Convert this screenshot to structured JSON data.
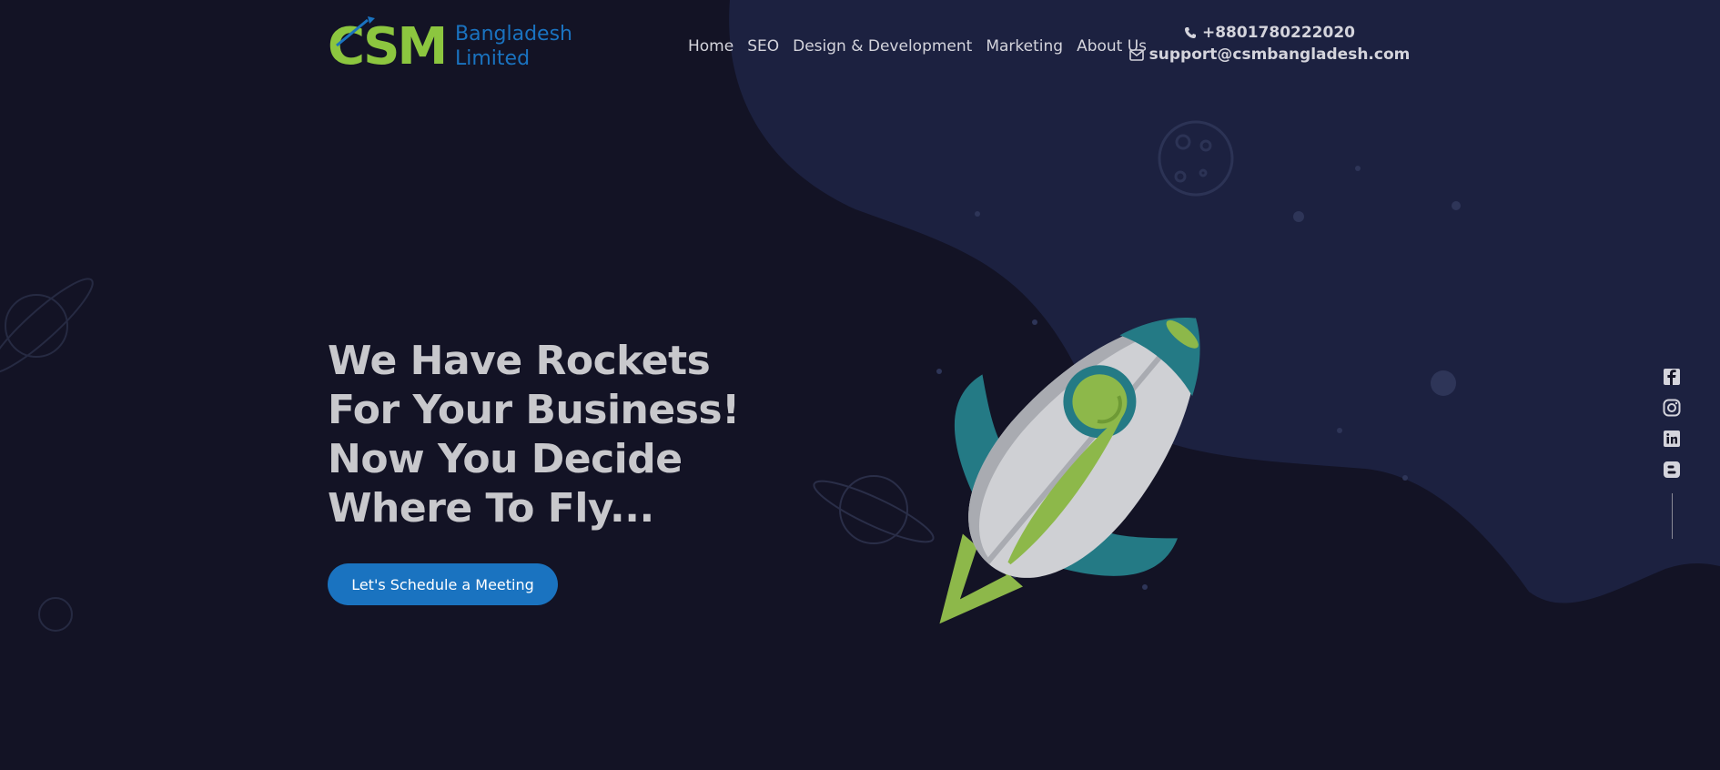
{
  "brand": {
    "logo_text": "CSM",
    "company_line1": "Bangladesh",
    "company_line2": "Limited",
    "colors": {
      "green": "#8cc63f",
      "blue": "#1a73c0"
    }
  },
  "nav": {
    "items": [
      {
        "label": "Home"
      },
      {
        "label": "SEO"
      },
      {
        "label": "Design & Development"
      },
      {
        "label": "Marketing"
      },
      {
        "label": "About Us"
      }
    ]
  },
  "contact": {
    "phone": "+8801780222020",
    "email": "support@csmbangladesh.com",
    "phone_icon": "phone-icon",
    "email_icon": "envelope-icon"
  },
  "hero": {
    "title_lines": [
      "We Have Rockets",
      "For Your Business!",
      "Now You Decide",
      "Where To Fly..."
    ],
    "cta_label": "Let's Schedule a Meeting"
  },
  "social": {
    "icons": [
      "facebook-icon",
      "instagram-icon",
      "linkedin-icon",
      "blogger-icon"
    ]
  },
  "theme": {
    "background": "#131325",
    "wave": "#1c2140",
    "text": "#c8c8cc",
    "accent": "#1a73c0"
  }
}
